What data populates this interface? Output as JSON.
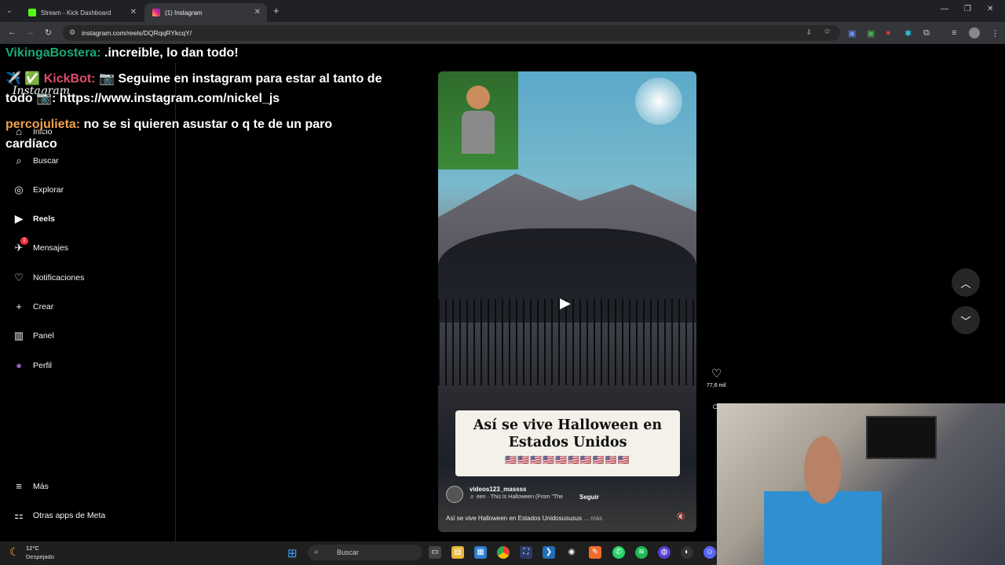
{
  "browser": {
    "tabs": [
      {
        "label": "Stream - Kick Dashboard",
        "favicon_color": "#53fc18"
      },
      {
        "label": "(1) Instagram",
        "favicon_color": "#d62976"
      }
    ],
    "url": "instagram.com/reels/DQRqqRYkcqY/"
  },
  "chat": [
    {
      "user": "VikingaBostera:",
      "user_color": "#19a974",
      "message": ".increible, lo dan todo!"
    },
    {
      "badges": "✈️ ✅",
      "user": "KickBot:",
      "user_color": "#e14c6e",
      "message": "📷 Seguime en instagram para estar al tanto de todo 📷: https://www.instagram.com/nickel_js",
      "line1": "📷 Seguime en instagram para estar al tanto de",
      "line2_prefix": "todo",
      "line2": "📷: https://www.instagram.com/nickel_js"
    },
    {
      "user": "percojulieta:",
      "user_color": "#f0a04b",
      "message": "no se si quieren asustar o q te de un paro",
      "line2": "cardíaco"
    }
  ],
  "instagram": {
    "logo": "Instagram",
    "nav": [
      {
        "label": "Inicio",
        "icon": "home-icon"
      },
      {
        "label": "Buscar",
        "icon": "search-icon"
      },
      {
        "label": "Explorar",
        "icon": "compass-icon"
      },
      {
        "label": "Reels",
        "icon": "reels-icon"
      },
      {
        "label": "Mensajes",
        "icon": "messenger-icon",
        "badge": "1"
      },
      {
        "label": "Notificaciones",
        "icon": "heart-icon"
      },
      {
        "label": "Crear",
        "icon": "plus-icon"
      },
      {
        "label": "Panel",
        "icon": "chart-icon"
      },
      {
        "label": "Perfil",
        "icon": "avatar-icon"
      }
    ],
    "more": "Más",
    "meta_apps": "Otras apps de Meta",
    "reel": {
      "caption_line1": "Así se vive Halloween en",
      "caption_line2": "Estados Unidos",
      "flags": "🇺🇸🇺🇸🇺🇸🇺🇸🇺🇸🇺🇸🇺🇸🇺🇸🇺🇸🇺🇸",
      "username": "videos123_massss",
      "audio": "♬ een · This Is Halloween (From \"The",
      "follow": "Seguir",
      "description": "Así se vive Halloween en Estados Unidosususus",
      "description_more": "... más",
      "likes": "77,6 mil"
    }
  },
  "taskbar": {
    "temperature": "12°C",
    "condition": "Despejado",
    "search": "Buscar"
  }
}
